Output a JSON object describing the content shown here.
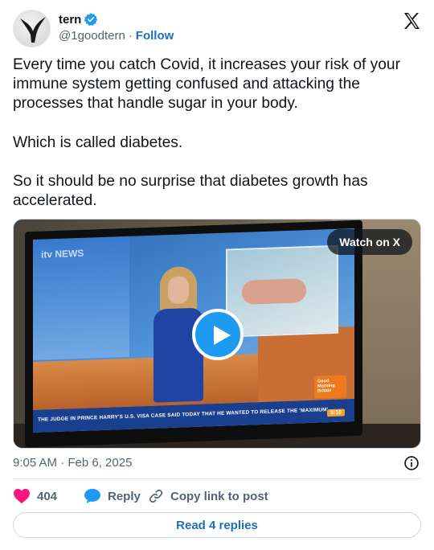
{
  "author": {
    "name": "tern",
    "handle": "@1goodtern",
    "separator": "·",
    "follow_label": "Follow",
    "verified": true,
    "avatar_icon": "bird-silhouette-icon"
  },
  "platform_icon": "x-logo-icon",
  "tweet": {
    "paragraphs": [
      "Every time you catch Covid, it increases your risk of your immune system getting confused and attacking the processes that handle sugar in your body.",
      "Which is called diabetes.",
      "So it should be no surprise that diabetes growth has accelerated."
    ]
  },
  "media": {
    "watch_label": "Watch on X",
    "play_icon": "play-icon",
    "on_screen": {
      "channel_logo": "itv NEWS",
      "ticker": "THE JUDGE IN PRINCE HARRY'S U.S. VISA CASE SAID TODAY THAT HE WANTED TO RELEASE THE 'MAXIMUM'",
      "badge": "Good Morning Britain",
      "time": "9:10"
    }
  },
  "meta": {
    "timestamp": "9:05 AM · Feb 6, 2025",
    "info_icon": "info-icon"
  },
  "actions": {
    "like_count": "404",
    "reply_label": "Reply",
    "copy_label": "Copy link to post"
  },
  "read_replies_label": "Read 4 replies",
  "colors": {
    "accent": "#1d9bf0",
    "link": "#1d6fb8",
    "like": "#f91880",
    "muted": "#536471"
  }
}
